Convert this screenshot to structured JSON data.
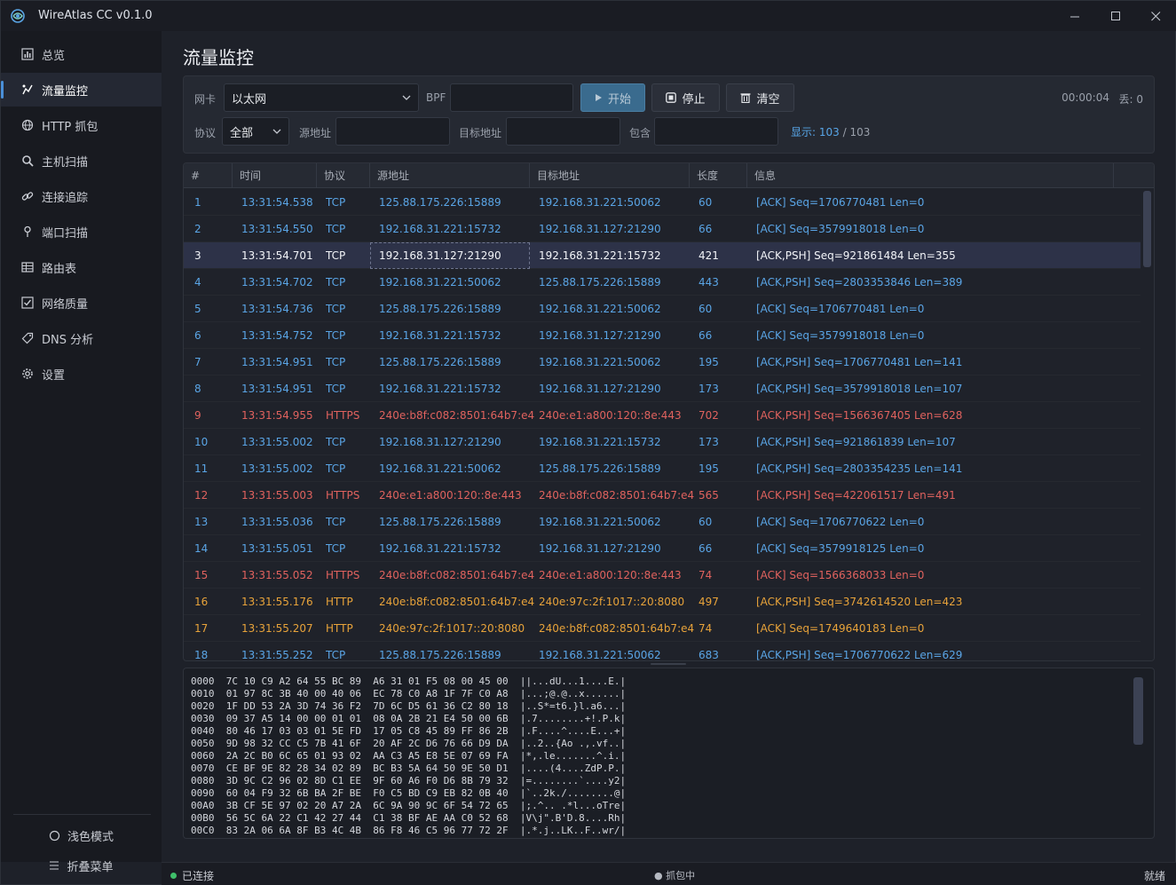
{
  "app": {
    "title": "WireAtlas CC v0.1.0"
  },
  "window_controls": {
    "minimize": "—",
    "maximize": "☐",
    "close": "✕"
  },
  "sidebar": {
    "items": [
      {
        "label": "总览",
        "icon": "chart-icon",
        "active": false
      },
      {
        "label": "流量监控",
        "icon": "pulse-icon",
        "active": true
      },
      {
        "label": "HTTP 抓包",
        "icon": "globe-icon",
        "active": false
      },
      {
        "label": "主机扫描",
        "icon": "search-icon",
        "active": false
      },
      {
        "label": "连接追踪",
        "icon": "link-icon",
        "active": false
      },
      {
        "label": "端口扫描",
        "icon": "pin-icon",
        "active": false
      },
      {
        "label": "路由表",
        "icon": "table-icon",
        "active": false
      },
      {
        "label": "网络质量",
        "icon": "check-square-icon",
        "active": false
      },
      {
        "label": "DNS 分析",
        "icon": "tag-icon",
        "active": false
      },
      {
        "label": "设置",
        "icon": "gear-icon",
        "active": false
      }
    ],
    "light_mode": "浅色模式",
    "collapse": "折叠菜单"
  },
  "page": {
    "title": "流量监控"
  },
  "toolbar": {
    "nic_label": "网卡",
    "nic_value": "以太网",
    "bpf_label": "BPF",
    "bpf_value": "",
    "start": "开始",
    "stop": "停止",
    "clear": "清空",
    "elapsed": "00:00:04",
    "dropped": "丢: 0",
    "proto_label": "协议",
    "proto_value": "全部",
    "src_label": "源地址",
    "src_value": "",
    "dst_label": "目标地址",
    "dst_value": "",
    "contains_label": "包含",
    "contains_value": "",
    "shown_prefix": "显示: 103",
    "shown_suffix": " / 103"
  },
  "colors": {
    "tcp": "#5aa5e6",
    "https": "#e0625e",
    "http": "#e8a33a",
    "accent": "#4a8fd8"
  },
  "table": {
    "columns": [
      "#",
      "时间",
      "协议",
      "源地址",
      "目标地址",
      "长度",
      "信息"
    ],
    "selected": 3,
    "rows": [
      [
        "1",
        "13:31:54.538",
        "TCP",
        "125.88.175.226:15889",
        "192.168.31.221:50062",
        "60",
        "[ACK] Seq=1706770481 Len=0"
      ],
      [
        "2",
        "13:31:54.550",
        "TCP",
        "192.168.31.221:15732",
        "192.168.31.127:21290",
        "66",
        "[ACK] Seq=3579918018 Len=0"
      ],
      [
        "3",
        "13:31:54.701",
        "TCP",
        "192.168.31.127:21290",
        "192.168.31.221:15732",
        "421",
        "[ACK,PSH] Seq=921861484 Len=355"
      ],
      [
        "4",
        "13:31:54.702",
        "TCP",
        "192.168.31.221:50062",
        "125.88.175.226:15889",
        "443",
        "[ACK,PSH] Seq=2803353846 Len=389"
      ],
      [
        "5",
        "13:31:54.736",
        "TCP",
        "125.88.175.226:15889",
        "192.168.31.221:50062",
        "60",
        "[ACK] Seq=1706770481 Len=0"
      ],
      [
        "6",
        "13:31:54.752",
        "TCP",
        "192.168.31.221:15732",
        "192.168.31.127:21290",
        "66",
        "[ACK] Seq=3579918018 Len=0"
      ],
      [
        "7",
        "13:31:54.951",
        "TCP",
        "125.88.175.226:15889",
        "192.168.31.221:50062",
        "195",
        "[ACK,PSH] Seq=1706770481 Len=141"
      ],
      [
        "8",
        "13:31:54.951",
        "TCP",
        "192.168.31.221:15732",
        "192.168.31.127:21290",
        "173",
        "[ACK,PSH] Seq=3579918018 Len=107"
      ],
      [
        "9",
        "13:31:54.955",
        "HTTPS",
        "240e:b8f:c082:8501:64b7:e4",
        "240e:e1:a800:120::8e:443",
        "702",
        "[ACK,PSH] Seq=1566367405 Len=628"
      ],
      [
        "10",
        "13:31:55.002",
        "TCP",
        "192.168.31.127:21290",
        "192.168.31.221:15732",
        "173",
        "[ACK,PSH] Seq=921861839 Len=107"
      ],
      [
        "11",
        "13:31:55.002",
        "TCP",
        "192.168.31.221:50062",
        "125.88.175.226:15889",
        "195",
        "[ACK,PSH] Seq=2803354235 Len=141"
      ],
      [
        "12",
        "13:31:55.003",
        "HTTPS",
        "240e:e1:a800:120::8e:443",
        "240e:b8f:c082:8501:64b7:e4",
        "565",
        "[ACK,PSH] Seq=422061517 Len=491"
      ],
      [
        "13",
        "13:31:55.036",
        "TCP",
        "125.88.175.226:15889",
        "192.168.31.221:50062",
        "60",
        "[ACK] Seq=1706770622 Len=0"
      ],
      [
        "14",
        "13:31:55.051",
        "TCP",
        "192.168.31.221:15732",
        "192.168.31.127:21290",
        "66",
        "[ACK] Seq=3579918125 Len=0"
      ],
      [
        "15",
        "13:31:55.052",
        "HTTPS",
        "240e:b8f:c082:8501:64b7:e4",
        "240e:e1:a800:120::8e:443",
        "74",
        "[ACK] Seq=1566368033 Len=0"
      ],
      [
        "16",
        "13:31:55.176",
        "HTTP",
        "240e:b8f:c082:8501:64b7:e4",
        "240e:97c:2f:1017::20:8080",
        "497",
        "[ACK,PSH] Seq=3742614520 Len=423"
      ],
      [
        "17",
        "13:31:55.207",
        "HTTP",
        "240e:97c:2f:1017::20:8080",
        "240e:b8f:c082:8501:64b7:e4",
        "74",
        "[ACK] Seq=1749640183 Len=0"
      ],
      [
        "18",
        "13:31:55.252",
        "TCP",
        "125.88.175.226:15889",
        "192.168.31.221:50062",
        "683",
        "[ACK,PSH] Seq=1706770622 Len=629"
      ]
    ]
  },
  "hexdump": [
    "0000  7C 10 C9 A2 64 55 BC 89  A6 31 01 F5 08 00 45 00  ||...dU...1....E.|",
    "0010  01 97 8C 3B 40 00 40 06  EC 78 C0 A8 1F 7F C0 A8  |...;@.@..x......|",
    "0020  1F DD 53 2A 3D 74 36 F2  7D 6C D5 61 36 C2 80 18  |..S*=t6.}l.a6...|",
    "0030  09 37 A5 14 00 00 01 01  08 0A 2B 21 E4 50 00 6B  |.7........+!.P.k|",
    "0040  80 46 17 03 03 01 5E FD  17 05 C8 45 89 FF 86 2B  |.F....^....E...+|",
    "0050  9D 98 32 CC C5 7B 41 6F  20 AF 2C D6 76 66 D9 DA  |..2..{Ao .,.vf..|",
    "0060  2A 2C B0 6C 65 01 93 02  AA C3 A5 E8 5E 07 69 FA  |*,.le.......^.i.|",
    "0070  CE BF 9E 82 28 34 02 89  BC B3 5A 64 50 9E 50 D1  |....(4....ZdP.P.|",
    "0080  3D 9C C2 96 02 8D C1 EE  9F 60 A6 F0 D6 8B 79 32  |=........`....y2|",
    "0090  60 04 F9 32 6B BA 2F BE  F0 C5 BD C9 EB 82 0B 40  |`..2k./........@|",
    "00A0  3B CF 5E 97 02 20 A7 2A  6C 9A 90 9C 6F 54 72 65  |;.^.. .*l...oTre|",
    "00B0  56 5C 6A 22 C1 42 27 44  C1 38 BF AE AA C0 52 68  |V\\j\".B'D.8....Rh|",
    "00C0  83 2A 06 6A 8F B3 4C 4B  86 F8 46 C5 96 77 72 2F  |.*.j..LK..F..wr/|"
  ],
  "statusbar": {
    "connected": "已连接",
    "capturing": "● 抓包中",
    "ready": "就绪"
  }
}
